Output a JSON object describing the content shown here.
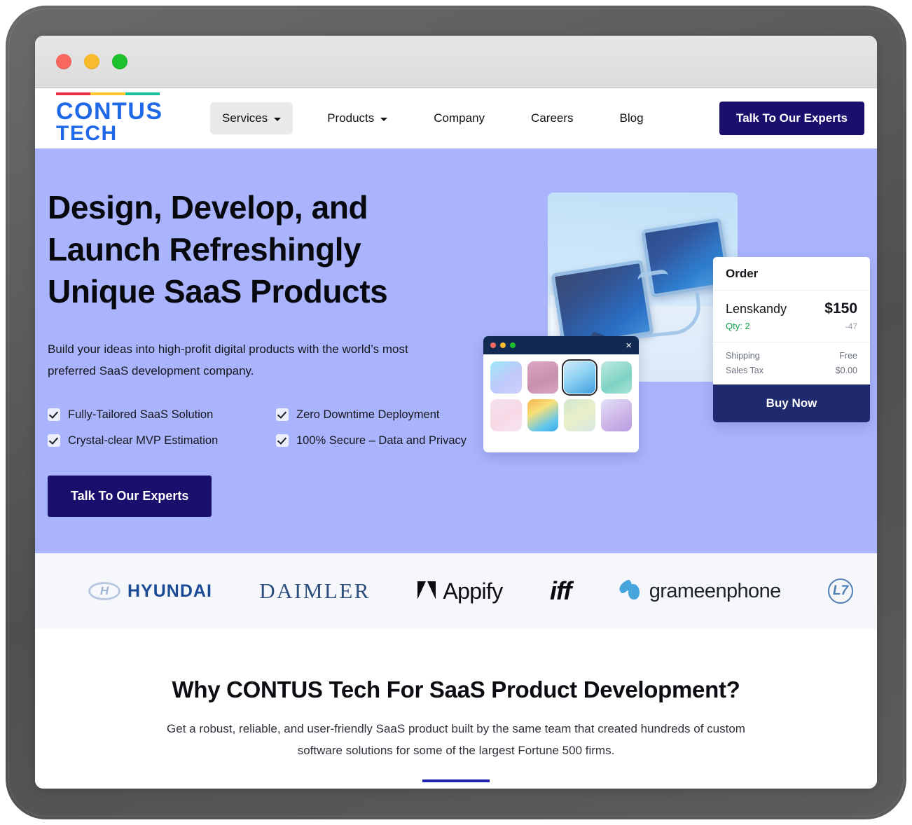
{
  "window": {
    "traffic_lights": [
      "close-red",
      "minimize-yellow",
      "maximize-green"
    ]
  },
  "header": {
    "logo": {
      "line1": "CONTUS",
      "line2": "TECH",
      "accent_bars": [
        "#ee2f45",
        "#fdc72f",
        "#18c39b"
      ],
      "color": "#1f68e8"
    },
    "nav": [
      {
        "label": "Services",
        "has_caret": true,
        "active": true
      },
      {
        "label": "Products",
        "has_caret": true,
        "active": false
      },
      {
        "label": "Company",
        "has_caret": false,
        "active": false
      },
      {
        "label": "Careers",
        "has_caret": false,
        "active": false
      },
      {
        "label": "Blog",
        "has_caret": false,
        "active": false
      }
    ],
    "cta_label": "Talk To Our Experts",
    "cta_color": "#1b0f6e"
  },
  "hero": {
    "background": "#aab4fd",
    "title_lines": [
      "Design, Develop, and",
      "Launch Refreshingly",
      "Unique SaaS Products"
    ],
    "subtitle": "Build your ideas into high-profit digital products with the world’s most preferred SaaS development company.",
    "features": [
      "Fully-Tailored SaaS Solution",
      "Zero Downtime Deployment",
      "Crystal-clear MVP Estimation",
      "100% Secure – Data and Privacy"
    ],
    "cta_label": "Talk To Our Experts"
  },
  "order_card": {
    "title": "Order",
    "item_name": "Lenskandy",
    "item_price": "$150",
    "item_qty": "Qty: 2",
    "item_discount": "-47",
    "summary": [
      {
        "label": "Shipping",
        "value": "Free"
      },
      {
        "label": "Sales Tax",
        "value": "$0.00"
      }
    ],
    "buy_label": "Buy Now",
    "buy_color": "#1f2a6e"
  },
  "browser_mock": {
    "close_glyph": "×",
    "swatches": [
      {
        "gradient": "linear-gradient(140deg,#9fe8f6 0%,#bfc9fb 55%,#cfd2fb 100%)",
        "selected": false
      },
      {
        "gradient": "linear-gradient(160deg,#d9a7c4 0%,#c98fae 60%,#d7a6c2 100%)",
        "selected": false
      },
      {
        "gradient": "linear-gradient(150deg,#cfeaf8 0%,#8fd2f2 45%,#3f9fe0 100%)",
        "selected": true
      },
      {
        "gradient": "linear-gradient(150deg,#bfe9e0 0%,#7fd3c4 60%,#a9e2d6 100%)",
        "selected": false
      },
      {
        "gradient": "linear-gradient(150deg,#f3e2ee 0%,#f8d9e6 55%,#f6e6f1 100%)",
        "selected": false
      },
      {
        "gradient": "linear-gradient(150deg,#f6b44c 0%,#f7e07a 35%,#5fc6ee 75%,#38a9e4 100%)",
        "selected": false
      },
      {
        "gradient": "linear-gradient(150deg,#cfe6d0 0%,#eaf0c8 50%,#d6e7e2 100%)",
        "selected": false
      },
      {
        "gradient": "linear-gradient(150deg,#dfe2f7 0%,#cfb6e8 55%,#b79ce0 100%)",
        "selected": false
      }
    ]
  },
  "clients": [
    {
      "name": "Hyundai",
      "text": "HYUNDAI"
    },
    {
      "name": "Daimler",
      "text": "DAIMLER"
    },
    {
      "name": "Appify",
      "text": "Appify"
    },
    {
      "name": "iff",
      "text": "iff"
    },
    {
      "name": "grameenphone",
      "text": "grameenphone"
    },
    {
      "name": "L&T",
      "text": "L7"
    }
  ],
  "why_section": {
    "title": "Why CONTUS Tech For SaaS Product Development?",
    "subtitle": "Get a robust, reliable, and user-friendly SaaS product built by the same team that created hundreds of custom software solutions for some of the largest Fortune 500 firms.",
    "rule_color": "#1f23b0"
  }
}
